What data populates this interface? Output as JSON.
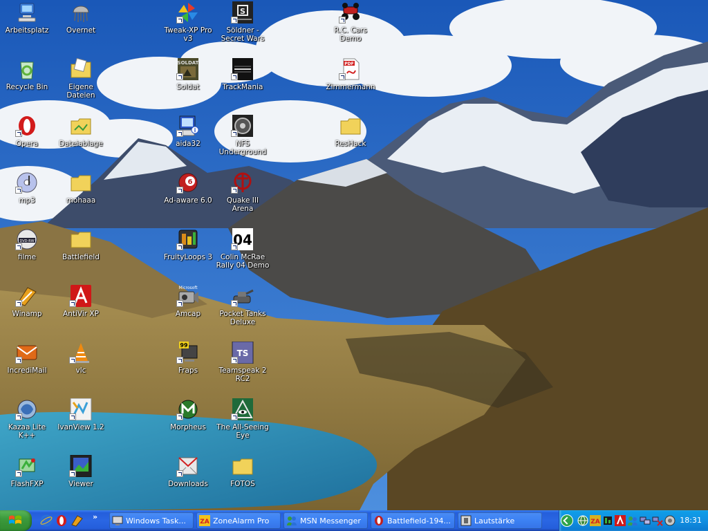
{
  "desktop": {
    "icons": [
      {
        "label": "Arbeitsplatz",
        "icon": "my-computer-icon",
        "shortcut": false,
        "color": "#3f7ed6"
      },
      {
        "label": "Overnet",
        "icon": "jellyfish-icon",
        "shortcut": false,
        "color": "#b8b8b8"
      },
      {
        "label": "Tweak-XP Pro v3",
        "icon": "pinwheel-icon",
        "shortcut": true,
        "color": "#e5a21a"
      },
      {
        "label": "Söldner - Secret Wars",
        "icon": "soeldner-logo-icon",
        "shortcut": true,
        "color": "#222222"
      },
      {
        "label": "R.C. Cars Demo",
        "icon": "rc-car-icon",
        "shortcut": true,
        "color": "#c02020"
      },
      {
        "label": "Recycle Bin",
        "icon": "recycle-bin-icon",
        "shortcut": false,
        "color": "#5fb33b"
      },
      {
        "label": "Eigene Dateien",
        "icon": "my-documents-folder-icon",
        "shortcut": false,
        "color": "#f1d25a"
      },
      {
        "label": "Soldat",
        "icon": "soldat-icon",
        "shortcut": true,
        "color": "#4a4a2a"
      },
      {
        "label": "TrackMania",
        "icon": "trackmania-icon",
        "shortcut": true,
        "color": "#111111"
      },
      {
        "label": "Zimmermann",
        "icon": "pdf-icon",
        "shortcut": true,
        "color": "#d22020"
      },
      {
        "label": "Opera",
        "icon": "opera-icon",
        "shortcut": true,
        "color": "#d21b1b"
      },
      {
        "label": "Dateiablage",
        "icon": "shared-folder-icon",
        "shortcut": false,
        "color": "#f1d25a"
      },
      {
        "label": "aida32",
        "icon": "aida32-icon",
        "shortcut": true,
        "color": "#2a57c8"
      },
      {
        "label": "NFS Underground",
        "icon": "nfs-icon",
        "shortcut": true,
        "color": "#333333"
      },
      {
        "label": "ResHack",
        "icon": "folder-icon",
        "shortcut": false,
        "color": "#f1d25a"
      },
      {
        "label": "mp3",
        "icon": "music-cd-icon",
        "shortcut": true,
        "color": "#7a8ad6"
      },
      {
        "label": "mohaaa",
        "icon": "folder-icon",
        "shortcut": false,
        "color": "#f1d25a"
      },
      {
        "label": "Ad-aware 6.0",
        "icon": "ad-aware-icon",
        "shortcut": true,
        "color": "#c22020"
      },
      {
        "label": "Quake III Arena",
        "icon": "quake-icon",
        "shortcut": true,
        "color": "#b01010"
      },
      {
        "label": "filme",
        "icon": "dvd-rw-icon",
        "shortcut": true,
        "color": "#dddddd"
      },
      {
        "label": "Battlefield",
        "icon": "folder-icon",
        "shortcut": false,
        "color": "#f1d25a"
      },
      {
        "label": "FruityLoops 3",
        "icon": "fruityloops-icon",
        "shortcut": true,
        "color": "#d98b1a"
      },
      {
        "label": "Colin McRae Rally 04 Demo",
        "icon": "colin-mcrae-04-icon",
        "shortcut": true,
        "color": "#000000",
        "badge": "04"
      },
      {
        "label": "Winamp",
        "icon": "winamp-icon",
        "shortcut": true,
        "color": "#e8a01c"
      },
      {
        "label": "AntiVir XP",
        "icon": "antivir-icon",
        "shortcut": true,
        "color": "#d01818"
      },
      {
        "label": "Amcap",
        "icon": "amcap-icon",
        "shortcut": true,
        "color": "#888888",
        "caption": "Microsoft"
      },
      {
        "label": "Pocket Tanks Deluxe",
        "icon": "pocket-tanks-icon",
        "shortcut": true,
        "color": "#5c5c5c"
      },
      {
        "label": "IncrediMail",
        "icon": "incredimail-icon",
        "shortcut": true,
        "color": "#e06a18"
      },
      {
        "label": "vlc",
        "icon": "vlc-cone-icon",
        "shortcut": true,
        "color": "#f08a10"
      },
      {
        "label": "Fraps",
        "icon": "fraps-icon",
        "shortcut": true,
        "color": "#f2d21a",
        "badge": "99"
      },
      {
        "label": "Teamspeak 2 RC2",
        "icon": "teamspeak-icon",
        "shortcut": true,
        "color": "#6a6aa8",
        "badge": "TS"
      },
      {
        "label": "Kazaa Lite K++",
        "icon": "kazaa-icon",
        "shortcut": true,
        "color": "#3a6fb8"
      },
      {
        "label": "IvanView 1.2",
        "icon": "ivanview-icon",
        "shortcut": true,
        "color": "#3aa0d8"
      },
      {
        "label": "Morpheus",
        "icon": "morpheus-icon",
        "shortcut": true,
        "color": "#2a7a2a"
      },
      {
        "label": "The All-Seeing Eye",
        "icon": "all-seeing-eye-icon",
        "shortcut": true,
        "color": "#1f6a3a"
      },
      {
        "label": "FlashFXP",
        "icon": "flashfxp-icon",
        "shortcut": true,
        "color": "#3ab03a"
      },
      {
        "label": "Viewer",
        "icon": "viewer-icon",
        "shortcut": true,
        "color": "#3a5fc8"
      },
      {
        "label": "Downloads",
        "icon": "downloads-icon",
        "shortcut": true,
        "color": "#d22020"
      },
      {
        "label": "FOTOS",
        "icon": "folder-icon",
        "shortcut": false,
        "color": "#f1d25a"
      }
    ]
  },
  "taskbar": {
    "start_icon": "windows-flag-icon",
    "quick_launch": [
      {
        "icon": "ie-icon",
        "color": "#2a6fd8"
      },
      {
        "icon": "opera-icon",
        "color": "#d21b1b"
      },
      {
        "icon": "winamp-icon",
        "color": "#e8a01c"
      }
    ],
    "quick_launch_more": "»",
    "tasks": [
      {
        "label": "Windows Task...",
        "icon": "task-manager-icon",
        "color": "#d8d8d8"
      },
      {
        "label": "ZoneAlarm Pro",
        "icon": "zonealarm-icon",
        "color": "#d22020"
      },
      {
        "label": "MSN Messenger",
        "icon": "msn-icon",
        "color": "#3a9a3a"
      },
      {
        "label": "Battlefield-194...",
        "icon": "battlefield-icon",
        "color": "#c02020"
      },
      {
        "label": "Lautstärke",
        "icon": "volume-icon",
        "color": "#d8d8d8"
      }
    ],
    "tray": {
      "icons": [
        {
          "icon": "tray-globe-icon",
          "color": "#3a8a3a"
        },
        {
          "icon": "tray-zonealarm-icon",
          "color": "#d8b020"
        },
        {
          "icon": "tray-meter-icon",
          "color": "#1a1a1a"
        },
        {
          "icon": "tray-antivir-icon",
          "color": "#d01818"
        },
        {
          "icon": "tray-msn-icon",
          "color": "#3aa04a"
        },
        {
          "icon": "tray-network-icon",
          "color": "#8a8ad0"
        },
        {
          "icon": "tray-network-error-icon",
          "color": "#d02020"
        },
        {
          "icon": "tray-update-icon",
          "color": "#707070"
        }
      ],
      "clock": "18:31"
    }
  }
}
